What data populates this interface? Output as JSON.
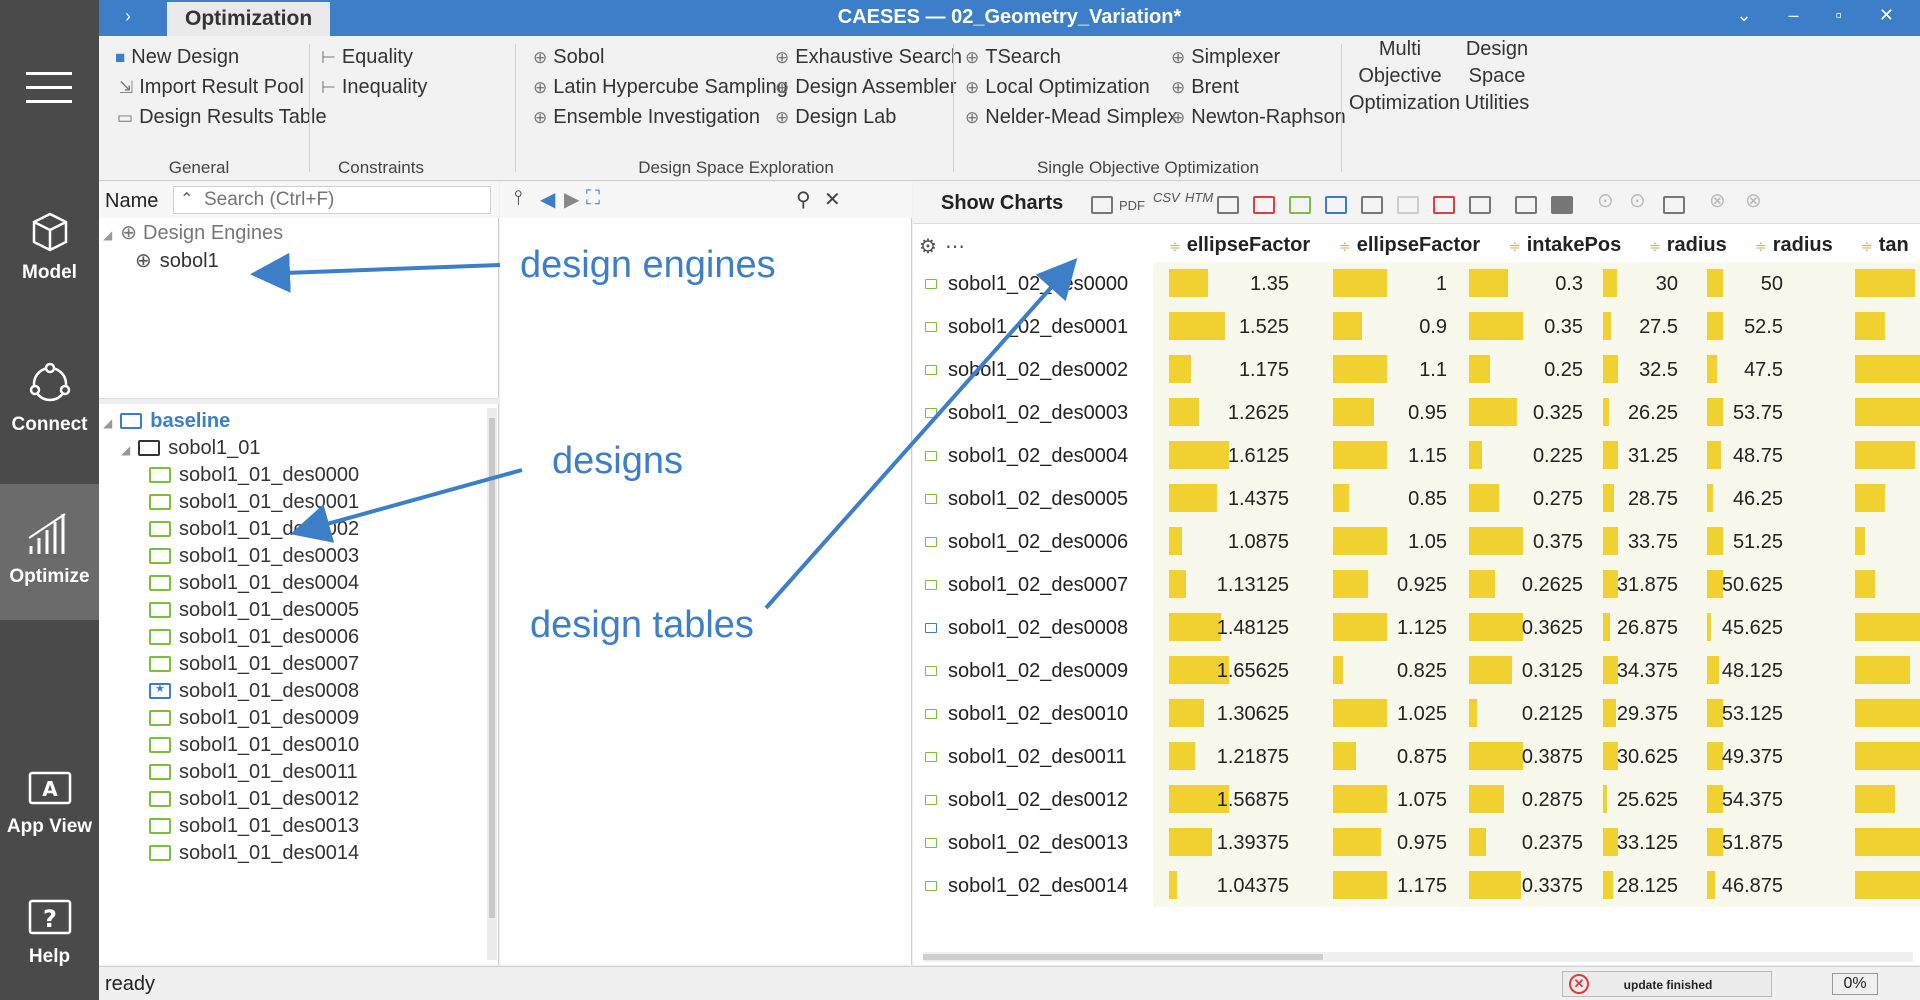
{
  "app": {
    "title": "CAESES  —  02_Geometry_Variation*",
    "active_tab": "Optimization",
    "win_controls": "⌄ ‒ ▫ ✕"
  },
  "leftnav": {
    "items": [
      {
        "label": "Model",
        "icon": "cube-icon"
      },
      {
        "label": "Connect",
        "icon": "connect-icon"
      },
      {
        "label": "Optimize",
        "icon": "bar-chart-icon"
      },
      {
        "label": "App View",
        "icon": "app-view-icon"
      },
      {
        "label": "Help",
        "icon": "help-icon"
      }
    ]
  },
  "ribbon": {
    "general": {
      "new_design": "New Design",
      "import_pool": "Import Result Pool",
      "results_table": "Design Results Table",
      "group": "General"
    },
    "constraints": {
      "equality": "Equality",
      "inequality": "Inequality",
      "group": "Constraints"
    },
    "dse": {
      "sobol": "Sobol",
      "lhs": "Latin Hypercube Sampling",
      "ensemble": "Ensemble Investigation",
      "exhaustive": "Exhaustive Search",
      "assembler": "Design Assembler",
      "lab": "Design Lab",
      "group": "Design Space Exploration"
    },
    "soo": {
      "tsearch": "TSearch",
      "local": "Local Optimization",
      "nelder": "Nelder-Mead Simplex",
      "simplexer": "Simplexer",
      "brent": "Brent",
      "newton": "Newton-Raphson",
      "group": "Single Objective Optimization"
    },
    "multi": "Multi\nObjective\nOptimization",
    "dsu": "Design\nSpace\nUtilities"
  },
  "left_panel": {
    "name_label": "Name",
    "search_placeholder": "Search (Ctrl+F)",
    "engines_root": "Design Engines",
    "engine": "sobol1",
    "baseline": "baseline",
    "group": "sobol1_01",
    "designs": [
      "sobol1_01_des0000",
      "sobol1_01_des0001",
      "sobol1_01_des0002",
      "sobol1_01_des0003",
      "sobol1_01_des0004",
      "sobol1_01_des0005",
      "sobol1_01_des0006",
      "sobol1_01_des0007",
      "sobol1_01_des0008",
      "sobol1_01_des0009",
      "sobol1_01_des0010",
      "sobol1_01_des0011",
      "sobol1_01_des0012",
      "sobol1_01_des0013",
      "sobol1_01_des0014"
    ]
  },
  "table": {
    "show_charts": "Show Charts",
    "toolbar_labels": {
      "pdf": "PDF",
      "csv": "CSV",
      "htm": "HTM"
    },
    "headers": [
      "ellipseFactor",
      "ellipseFactor",
      "intakePos",
      "radius",
      "radius",
      "tan"
    ],
    "rows": [
      {
        "name": "sobol1_02_des0000",
        "v": [
          "1.35",
          "1",
          "0.3",
          "30",
          "50"
        ]
      },
      {
        "name": "sobol1_02_des0001",
        "v": [
          "1.525",
          "0.9",
          "0.35",
          "27.5",
          "52.5"
        ]
      },
      {
        "name": "sobol1_02_des0002",
        "v": [
          "1.175",
          "1.1",
          "0.25",
          "32.5",
          "47.5"
        ]
      },
      {
        "name": "sobol1_02_des0003",
        "v": [
          "1.2625",
          "0.95",
          "0.325",
          "26.25",
          "53.75"
        ]
      },
      {
        "name": "sobol1_02_des0004",
        "v": [
          "1.6125",
          "1.15",
          "0.225",
          "31.25",
          "48.75"
        ]
      },
      {
        "name": "sobol1_02_des0005",
        "v": [
          "1.4375",
          "0.85",
          "0.275",
          "28.75",
          "46.25"
        ]
      },
      {
        "name": "sobol1_02_des0006",
        "v": [
          "1.0875",
          "1.05",
          "0.375",
          "33.75",
          "51.25"
        ]
      },
      {
        "name": "sobol1_02_des0007",
        "v": [
          "1.13125",
          "0.925",
          "0.2625",
          "31.875",
          "50.625"
        ]
      },
      {
        "name": "sobol1_02_des0008",
        "v": [
          "1.48125",
          "1.125",
          "0.3625",
          "26.875",
          "45.625"
        ]
      },
      {
        "name": "sobol1_02_des0009",
        "v": [
          "1.65625",
          "0.825",
          "0.3125",
          "34.375",
          "48.125"
        ]
      },
      {
        "name": "sobol1_02_des0010",
        "v": [
          "1.30625",
          "1.025",
          "0.2125",
          "29.375",
          "53.125"
        ]
      },
      {
        "name": "sobol1_02_des0011",
        "v": [
          "1.21875",
          "0.875",
          "0.3875",
          "30.625",
          "49.375"
        ]
      },
      {
        "name": "sobol1_02_des0012",
        "v": [
          "1.56875",
          "1.075",
          "0.2875",
          "25.625",
          "54.375"
        ]
      },
      {
        "name": "sobol1_02_des0013",
        "v": [
          "1.39375",
          "0.975",
          "0.2375",
          "33.125",
          "51.875"
        ]
      },
      {
        "name": "sobol1_02_des0014",
        "v": [
          "1.04375",
          "1.175",
          "0.3375",
          "28.125",
          "46.875"
        ]
      }
    ]
  },
  "annotations": {
    "engines": "design engines",
    "designs": "designs",
    "tables": "design tables"
  },
  "status": {
    "ready": "ready",
    "update": "update finished",
    "percent": "0%"
  },
  "colors": {
    "accent": "#3d7ec9",
    "bar": "#f0d12f",
    "folder": "#7cbf3a"
  }
}
